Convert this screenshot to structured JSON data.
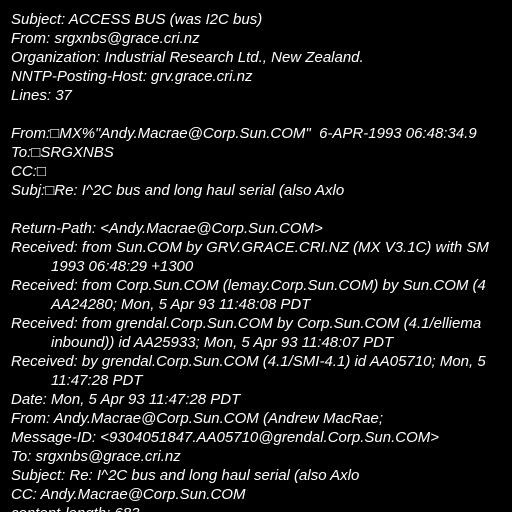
{
  "header": {
    "subject": "Subject: ACCESS BUS (was I2C bus)",
    "from": "From: srgxnbs@grace.cri.nz",
    "organization": "Organization: Industrial Research Ltd., New Zealand.",
    "nntp_host": "NNTP-Posting-Host: grv.grace.cri.nz",
    "lines": "Lines: 37"
  },
  "vms_header": {
    "from": "From:□MX%\"Andy.Macrae@Corp.Sun.COM\"  6-APR-1993 06:48:34.9",
    "to": "To:□SRGXNBS",
    "cc": "CC:□",
    "subj": "Subj:□Re: I^2C bus and long haul serial (also Axlo"
  },
  "mail_header": [
    {
      "text": "Return-Path: <Andy.Macrae@Corp.Sun.COM>",
      "indent": false
    },
    {
      "text": "Received: from Sun.COM by GRV.GRACE.CRI.NZ (MX V3.1C) with SM",
      "indent": false
    },
    {
      "text": "1993 06:48:29 +1300",
      "indent": true
    },
    {
      "text": "Received: from Corp.Sun.COM (lemay.Corp.Sun.COM) by Sun.COM (4",
      "indent": false
    },
    {
      "text": "AA24280; Mon, 5 Apr 93 11:48:08 PDT",
      "indent": true
    },
    {
      "text": "Received: from grendal.Corp.Sun.COM by Corp.Sun.COM (4.1/elliema",
      "indent": false
    },
    {
      "text": "inbound)) id AA25933; Mon, 5 Apr 93 11:48:07 PDT",
      "indent": true
    },
    {
      "text": "Received: by grendal.Corp.Sun.COM (4.1/SMI-4.1) id AA05710; Mon, 5",
      "indent": false
    },
    {
      "text": "11:47:28 PDT",
      "indent": true
    },
    {
      "text": "Date: Mon, 5 Apr 93 11:47:28 PDT",
      "indent": false
    },
    {
      "text": "From: Andy.Macrae@Corp.Sun.COM (Andrew MacRae;",
      "indent": false
    },
    {
      "text": "Message-ID: <9304051847.AA05710@grendal.Corp.Sun.COM>",
      "indent": false
    },
    {
      "text": "To: srgxnbs@grace.cri.nz",
      "indent": false
    },
    {
      "text": "Subject: Re: I^2C bus and long haul serial (also Axlo",
      "indent": false
    },
    {
      "text": "CC: Andy.Macrae@Corp.Sun.COM",
      "indent": false
    },
    {
      "text": "content-length: 683",
      "indent": false
    }
  ],
  "colors": {
    "background": "#000000",
    "text": "#ffffff"
  }
}
